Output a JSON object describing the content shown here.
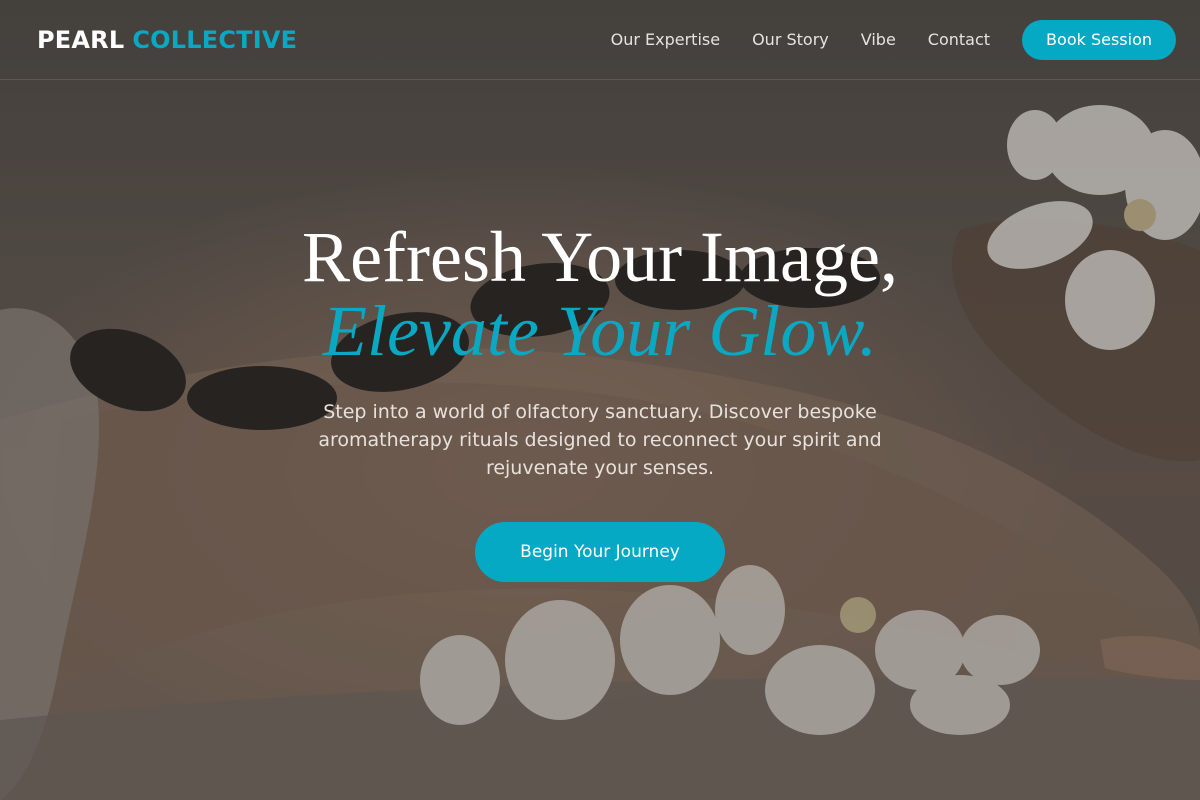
{
  "brand": {
    "name_part1": "PEARL",
    "name_part2": "COLLECTIVE",
    "accent_color": "#05a9c4"
  },
  "nav": {
    "items": [
      {
        "label": "Our Expertise"
      },
      {
        "label": "Our Story"
      },
      {
        "label": "Vibe"
      },
      {
        "label": "Contact"
      }
    ],
    "cta_label": "Book Session"
  },
  "hero": {
    "headline_line1": "Refresh Your Image,",
    "headline_line2": "Elevate Your Glow.",
    "subtitle": "Step into a world of olfactory sanctuary. Discover bespoke aromatherapy rituals designed to reconnect your spirit and rejuvenate your senses.",
    "cta_label": "Begin Your Journey",
    "background_image": "spa-hot-stones-orchids-photo"
  }
}
